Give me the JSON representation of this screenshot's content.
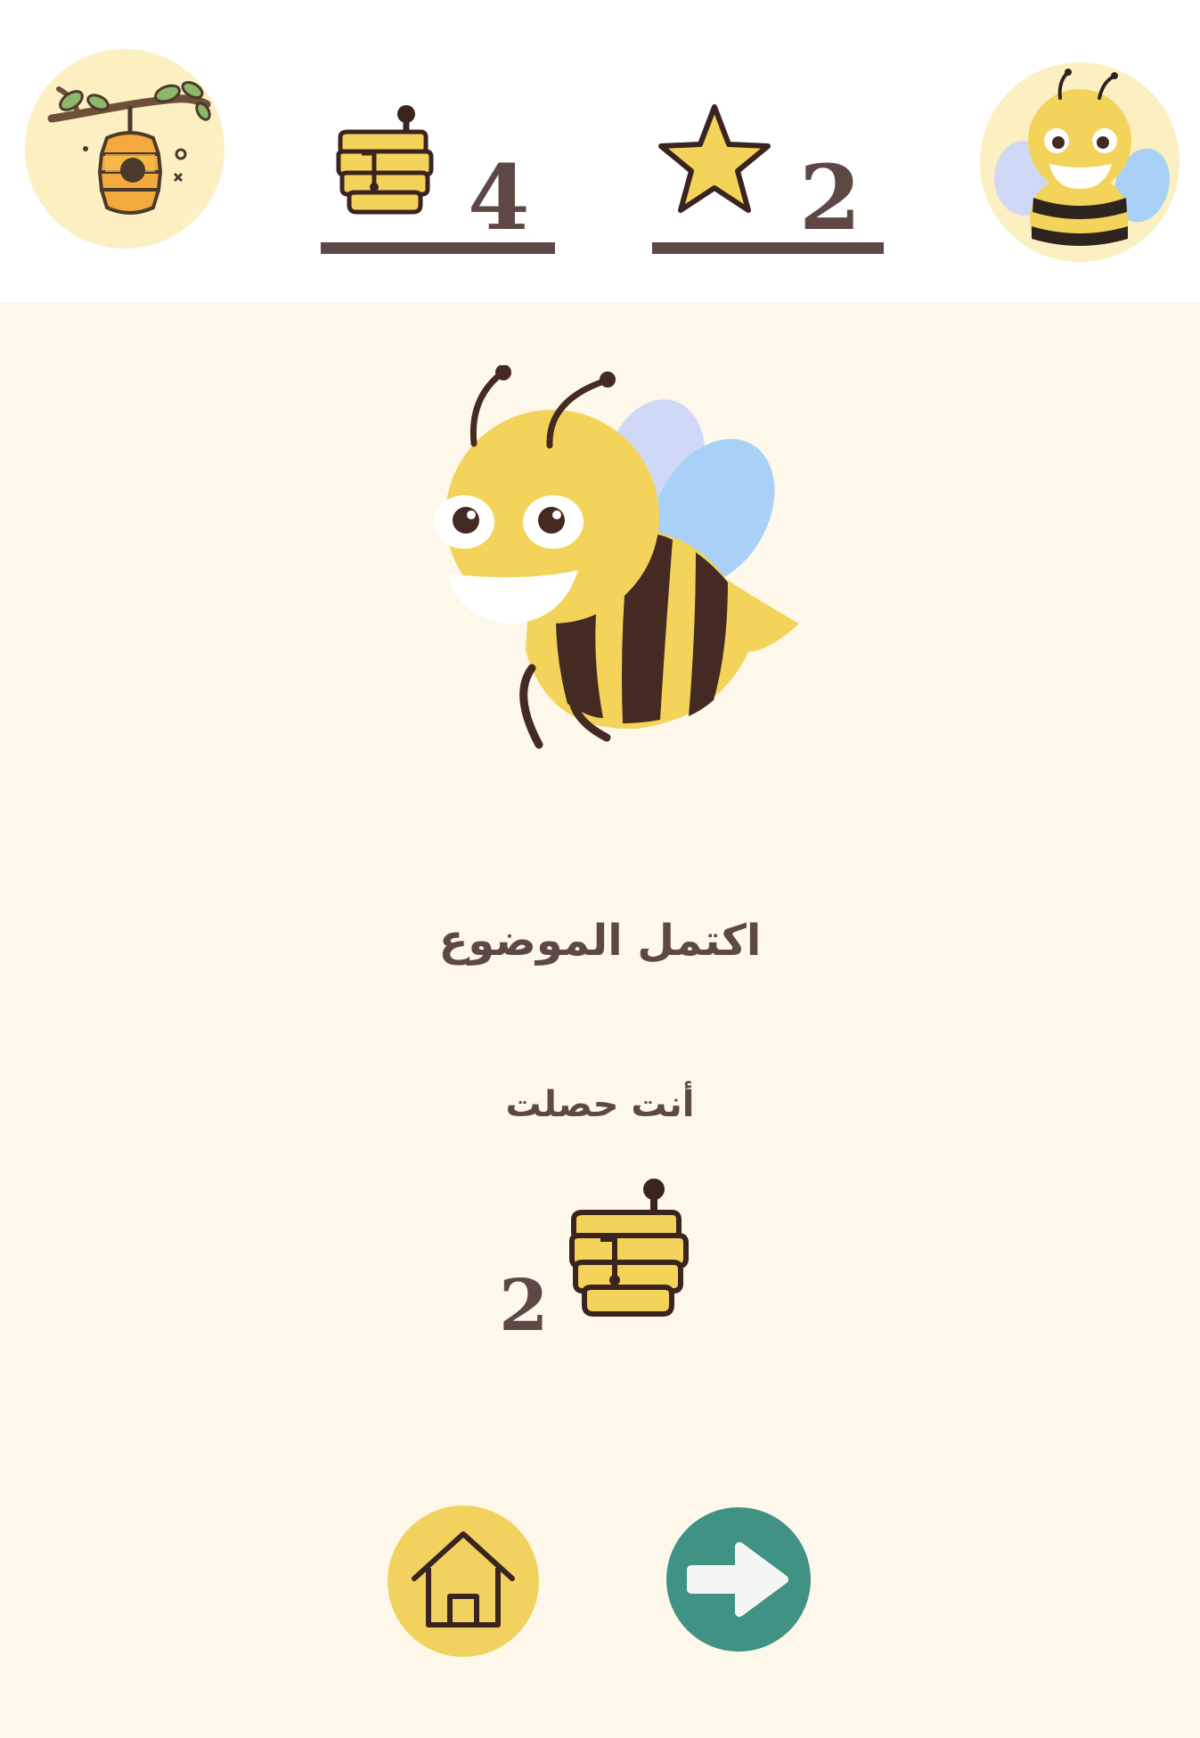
{
  "stats": {
    "honey_count": "4",
    "star_count": "2"
  },
  "completion": {
    "title": "اكتمل الموضوع",
    "subtitle": "أنت حصلت",
    "reward_count": "2"
  },
  "icons": {
    "hive": "beehive-icon",
    "avatar": "bee-avatar-icon",
    "honey": "honeycomb-icon",
    "star": "star-icon",
    "home": "home-icon",
    "next": "arrow-right-icon"
  },
  "colors": {
    "background": "#fdf8e9",
    "header": "#ffffff",
    "text": "#5e4846",
    "bee_yellow": "#f3d35a",
    "bee_dark": "#442a22",
    "wing_blue": "#a9d0f6",
    "wing_lavender": "#cfd8f6",
    "home_button": "#f2d25e",
    "next_button": "#3f9284",
    "badge": "#fcefc2"
  }
}
